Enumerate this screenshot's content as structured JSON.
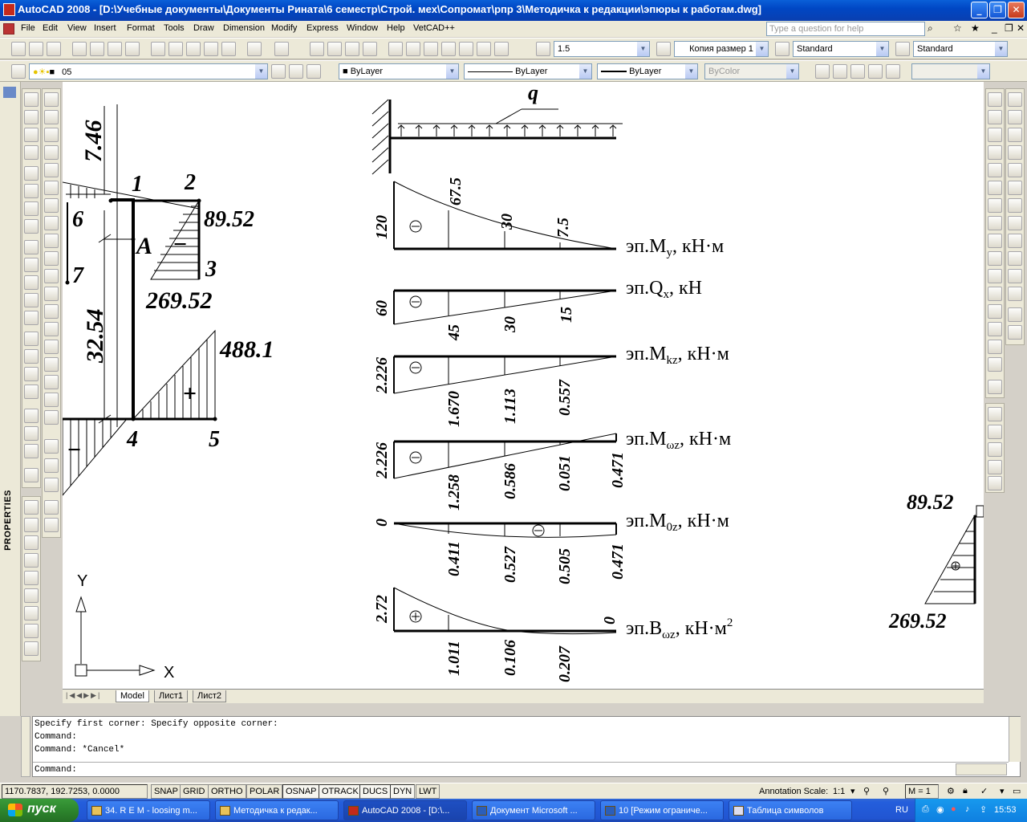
{
  "window": {
    "title": "AutoCAD 2008 - [D:\\Учебные документы\\Документы Рината\\6 семестр\\Строй. мех\\Сопромат\\рпр 3\\Методичка к редакции\\эпюры к работам.dwg]",
    "min": "_",
    "max": "❐",
    "close": "✕"
  },
  "menu": {
    "items": [
      "File",
      "Edit",
      "View",
      "Insert",
      "Format",
      "Tools",
      "Draw",
      "Dimension",
      "Modify",
      "Express",
      "Window",
      "Help",
      "VetCAD++"
    ],
    "help_placeholder": "Type a question for help"
  },
  "toolbar": {
    "text_height": "1.5",
    "dim_style": "Копия размер 1",
    "text_style": "Standard",
    "table_style": "Standard",
    "layer": "05",
    "color": "ByLayer",
    "linetype": "ByLayer",
    "lineweight": "ByLayer",
    "plotstyle": "ByColor"
  },
  "properties_label": "PROPERTIES",
  "drawing": {
    "left": {
      "dim_top": "7.46",
      "dim_mid": "32.54",
      "pt1": "1",
      "pt2": "2",
      "pt3": "3",
      "pt4": "4",
      "pt5": "5",
      "pt6": "6",
      "pt7": "7",
      "A": "A",
      "v89": "89.52",
      "v269": "269.52",
      "v488": "488.1",
      "minus": "−",
      "plus": "+"
    },
    "beam": {
      "q": "q"
    },
    "My": {
      "label": "эп.M",
      "sub": "y",
      "unit": ", кН·м",
      "v0": "120",
      "v1": "67.5",
      "v2": "30",
      "v3": "7.5"
    },
    "Qx": {
      "label": "эп.Q",
      "sub": "x",
      "unit": ", кН",
      "v0": "60",
      "v1": "45",
      "v2": "30",
      "v3": "15"
    },
    "Mkz": {
      "label": "эп.M",
      "sub": "kz",
      "unit": ", кН·м",
      "v0": "2.226",
      "v1": "1.670",
      "v2": "1.113",
      "v3": "0.557"
    },
    "Mwz": {
      "label": "эп.M",
      "sub": "ωz",
      "unit": ", кН·м",
      "v0": "2.226",
      "v1": "1.258",
      "v2": "0.586",
      "v3": "0.051",
      "v4": "0.471"
    },
    "M0z": {
      "label": "эп.M",
      "sub": "0z",
      "unit": ", кН·м",
      "v0": "0",
      "v1": "0.411",
      "v2": "0.527",
      "v3": "0.505",
      "v4": "0.471"
    },
    "Bwz": {
      "label": "эп.B",
      "sub": "ωz",
      "unit": ", кН·м",
      "sup": "2",
      "v0": "2.72",
      "v1": "1.011",
      "v2": "0.106",
      "v3": "0.207",
      "v4": "0"
    },
    "right": {
      "v89": "89.52",
      "v269": "269.52"
    },
    "ucs": {
      "y": "Y",
      "x": "X"
    }
  },
  "layout_tabs": [
    "Model",
    "Лист1",
    "Лист2"
  ],
  "command": {
    "lines": [
      "Specify first corner: Specify opposite corner:",
      "Command:",
      "Command: *Cancel*"
    ],
    "prompt": "Command:"
  },
  "status": {
    "coords": "1170.7837, 192.7253, 0.0000",
    "toggles": [
      "SNAP",
      "GRID",
      "ORTHO",
      "POLAR",
      "OSNAP",
      "OTRACK",
      "DUCS",
      "DYN",
      "LWT"
    ],
    "annotation_scale_label": "Annotation Scale:",
    "annotation_scale": "1:1",
    "m": "M = 1"
  },
  "taskbar": {
    "start": "пуск",
    "tasks": [
      "34. R E M - loosing m...",
      "Методичка к редак...",
      "AutoCAD 2008 - [D:\\...",
      "Документ Microsoft ...",
      "10 [Режим ограниче...",
      "Таблица символов"
    ],
    "lang": "RU",
    "time": "15:53"
  }
}
